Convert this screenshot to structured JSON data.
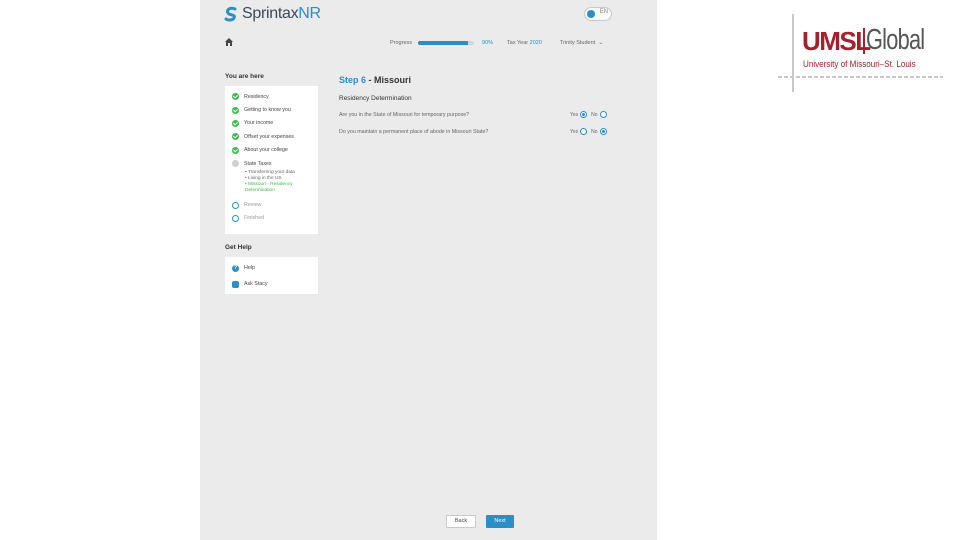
{
  "header": {
    "logo_prefix": "Sprintax",
    "logo_suffix": "NR",
    "toggle_label": "EN",
    "progress_label": "Progress",
    "progress_value": 0.9,
    "progress_percent": "90%",
    "tax_year_label": "Tax Year",
    "tax_year": "2020",
    "user_name": "Trinity Student"
  },
  "sidebar": {
    "title": "You are here",
    "steps": [
      {
        "label": "Residency",
        "state": "done"
      },
      {
        "label": "Getting to know you",
        "state": "done"
      },
      {
        "label": "Your income",
        "state": "done"
      },
      {
        "label": "Offset your expenses",
        "state": "done"
      },
      {
        "label": "About your college",
        "state": "done"
      },
      {
        "label": "State Taxes",
        "state": "pending"
      }
    ],
    "substeps": [
      {
        "label": "Transferring your data",
        "active": false
      },
      {
        "label": "Living in the US",
        "active": false
      },
      {
        "label": "Missouri - Residency Determination",
        "active": true
      }
    ],
    "later_steps": [
      {
        "label": "Review",
        "state": "clock"
      },
      {
        "label": "Finished",
        "state": "clock"
      }
    ],
    "help_title": "Get Help",
    "help_items": [
      {
        "label": "Help",
        "icon": "question-icon"
      },
      {
        "label": "Ask Stacy",
        "icon": "chat-icon"
      }
    ]
  },
  "main": {
    "step_number": "Step 6",
    "step_state": " - Missouri",
    "form_title": "Residency Determination",
    "questions": [
      {
        "text": "Are you in the State of Missouri for temporary purpose?",
        "yes": "Yes",
        "no": "No",
        "selected": "yes"
      },
      {
        "text": "Do you maintain a permanent place of abode in Missouri State?",
        "yes": "Yes",
        "no": "No",
        "selected": "no"
      }
    ],
    "back_label": "Back",
    "next_label": "Next"
  },
  "branding": {
    "umsl": "UMSL",
    "global": "Global",
    "university": "University of Missouri–St. Louis"
  },
  "colors": {
    "accent": "#2a8ec8",
    "success": "#3cbc4c",
    "brand_red": "#a6202c"
  }
}
